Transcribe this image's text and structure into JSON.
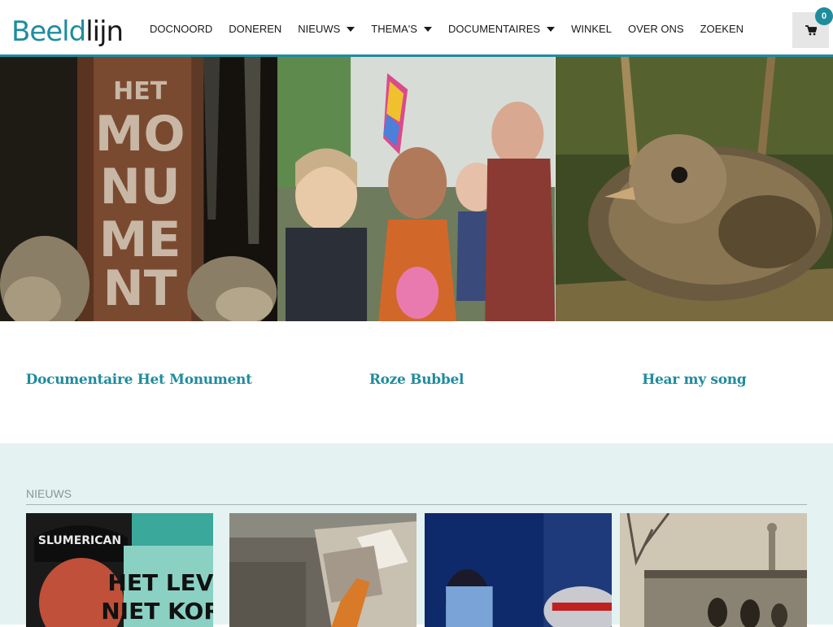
{
  "header": {
    "logo_part1": "Beeld",
    "logo_part2": "lijn",
    "nav": [
      {
        "label": "DOCNOORD",
        "dropdown": false
      },
      {
        "label": "DONEREN",
        "dropdown": false
      },
      {
        "label": "NIEUWS",
        "dropdown": true
      },
      {
        "label": "THEMA'S",
        "dropdown": true
      },
      {
        "label": "DOCUMENTAIRES",
        "dropdown": true
      },
      {
        "label": "WINKEL",
        "dropdown": false
      },
      {
        "label": "OVER ONS",
        "dropdown": false
      },
      {
        "label": "ZOEKEN",
        "dropdown": false
      }
    ],
    "cart_count": "0",
    "cart_icon": "shopping-cart-icon"
  },
  "hero": {
    "tile1_image_text": [
      "HET",
      "MO",
      "NU",
      "ME",
      "NT"
    ]
  },
  "featured": [
    {
      "title": "Documentaire Het Monument"
    },
    {
      "title": "Roze Bubbel"
    },
    {
      "title": "Hear my song"
    }
  ],
  "news": {
    "heading": "NIEUWS",
    "card1_image_text": [
      "SLUMERICAN",
      "HET LEVE",
      "NIET KORT"
    ]
  },
  "colors": {
    "accent": "#1f8c9e",
    "news_bg": "#e4f2f2",
    "text": "#1a1a1a"
  }
}
